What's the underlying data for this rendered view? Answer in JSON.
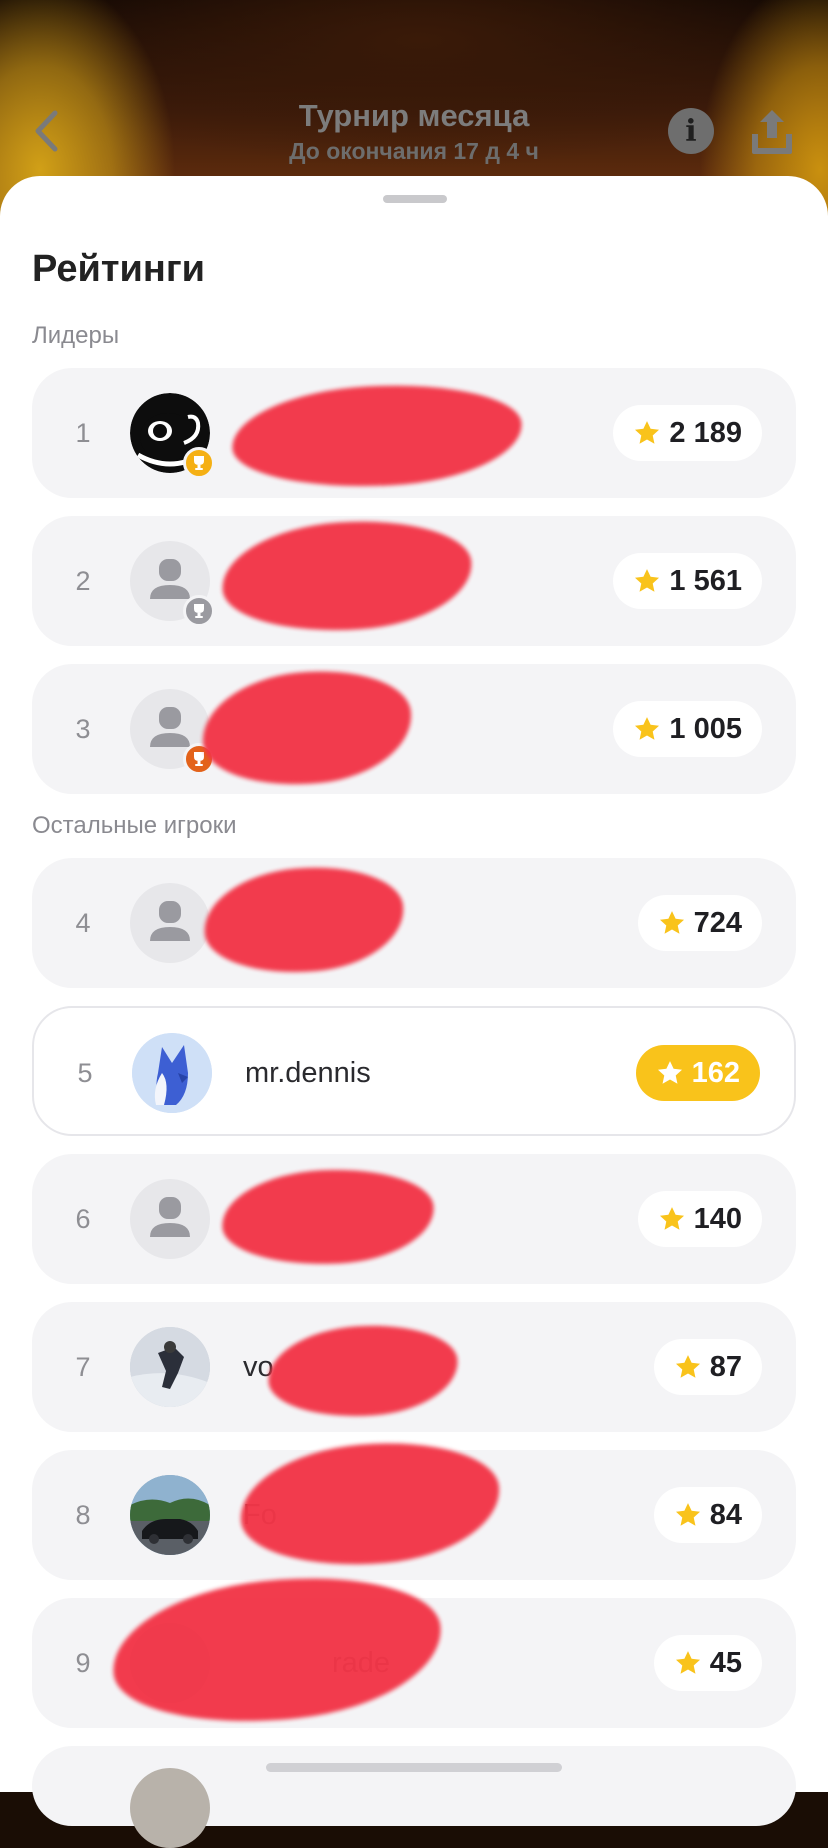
{
  "header": {
    "title": "Турнир месяца",
    "subtitle": "До окончания 17 д 4 ч"
  },
  "ratings": {
    "heading": "Рейтинги",
    "leaders_label": "Лидеры",
    "others_label": "Остальные игроки"
  },
  "rows": [
    {
      "rank": "1",
      "name": "",
      "score": "2 189",
      "badge": "gold",
      "avatar": "black-cat"
    },
    {
      "rank": "2",
      "name": "",
      "score": "1 561",
      "badge": "silver",
      "avatar": "default"
    },
    {
      "rank": "3",
      "name": "",
      "score": "1 005",
      "badge": "bronze",
      "avatar": "default"
    },
    {
      "rank": "4",
      "name": "",
      "score": "724",
      "avatar": "default"
    },
    {
      "rank": "5",
      "name": "mr.dennis",
      "score": "162",
      "avatar": "fox",
      "is_current_user": true
    },
    {
      "rank": "6",
      "name": "",
      "score": "140",
      "avatar": "default"
    },
    {
      "rank": "7",
      "name": "vo",
      "score": "87",
      "avatar": "snow-photo"
    },
    {
      "rank": "8",
      "name": "Fo",
      "score": "84",
      "avatar": "car-photo"
    },
    {
      "rank": "9",
      "name": "rade",
      "score": "45",
      "avatar": "hidden"
    }
  ],
  "colors": {
    "accent": "#f9c31b",
    "gold": "#f5b014",
    "silver": "#9a9aa0",
    "bronze": "#e3621a",
    "redaction": "#f23648"
  },
  "icons": [
    "back-chevron-icon",
    "info-icon",
    "share-icon",
    "star-icon",
    "trophy-icon",
    "default-avatar-icon"
  ]
}
